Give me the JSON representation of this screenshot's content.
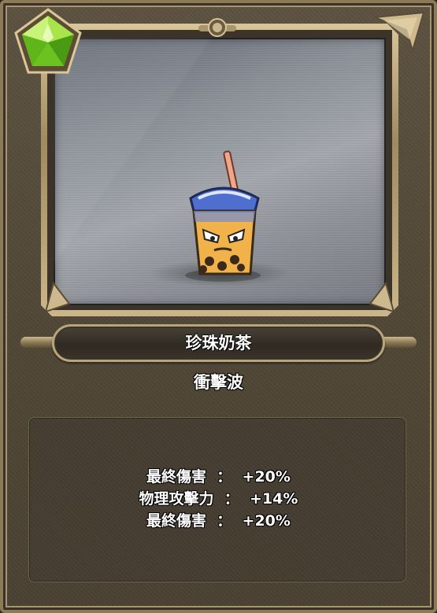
{
  "card": {
    "name": "珍珠奶茶",
    "skill": "衝擊波",
    "rarity_gem_color": "#7fd42a"
  },
  "stats": [
    {
      "label": "最終傷害",
      "sep": "：",
      "value": "+20%"
    },
    {
      "label": "物理攻擊力",
      "sep": "：",
      "value": "+14%"
    },
    {
      "label": "最終傷害",
      "sep": "：",
      "value": "+20%"
    }
  ]
}
